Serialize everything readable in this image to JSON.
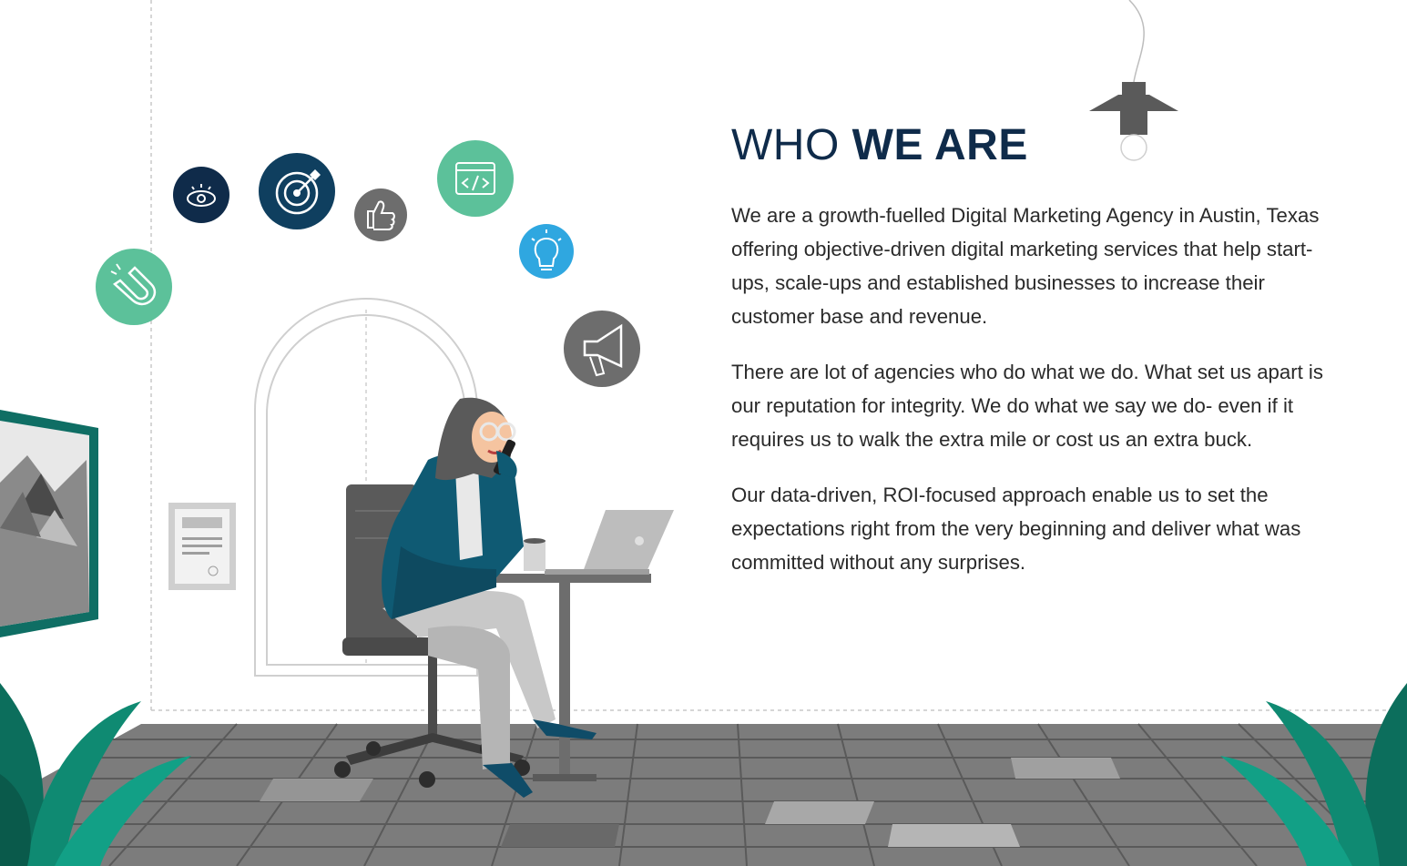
{
  "heading": {
    "light": "WHO ",
    "bold": "WE ARE"
  },
  "paragraphs": [
    "We are a growth-fuelled Digital Marketing Agency in Austin, Texas offering objective-driven digital marketing services that help start-ups, scale-ups and established businesses to increase their customer base and revenue.",
    "There are lot of agencies who do what we do. What set us apart is our reputation for integrity. We do what we say we do- even if it requires us to walk the extra mile or cost us an extra buck.",
    "Our data-driven, ROI-focused approach enable us to set the expectations right from the very beginning and deliver what was committed without any surprises."
  ],
  "icons": [
    {
      "name": "eye-icon",
      "color": "#0f2b4a"
    },
    {
      "name": "target-icon",
      "color": "#0f3f5f"
    },
    {
      "name": "thumbs-up-icon",
      "color": "#6d6d6d"
    },
    {
      "name": "code-icon",
      "color": "#5cc19a"
    },
    {
      "name": "lightbulb-icon",
      "color": "#2fa7e0"
    },
    {
      "name": "magnet-icon",
      "color": "#5cc19a"
    },
    {
      "name": "megaphone-icon",
      "color": "#6d6d6d"
    }
  ],
  "colors": {
    "heading": "#0f2b4a",
    "accent_teal": "#0f6e64",
    "plant": "#0f9a7f"
  }
}
